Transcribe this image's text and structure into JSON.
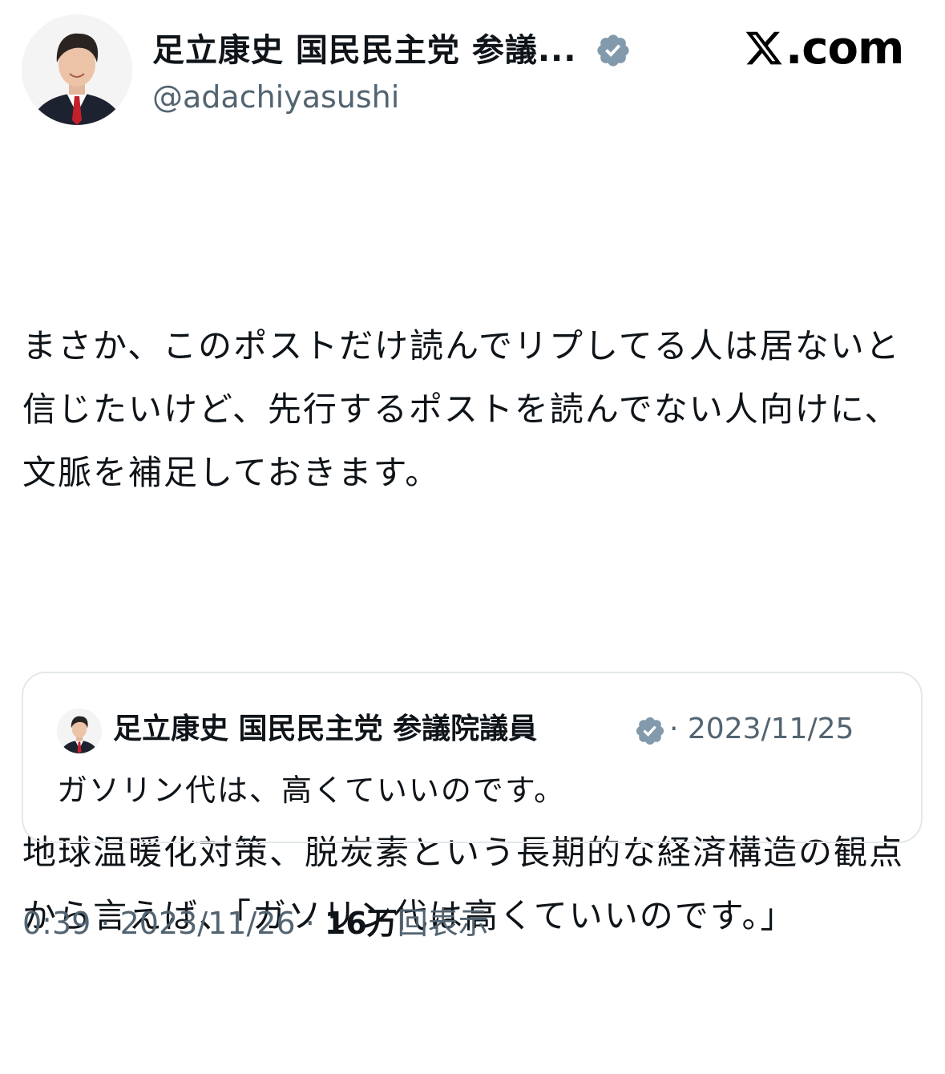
{
  "header": {
    "author_name": "足立康史 国民民主党 参議...",
    "handle": "@adachiyasushi",
    "verified_icon": "verified-badge-icon",
    "site_logo": ".com",
    "site_logo_icon": "x-logo-icon"
  },
  "post": {
    "paragraph1": "まさか、このポストだけ読んでリプしてる人は居ないと信じたいけど、先行するポストを読んでない人向けに、文脈を補足しておきます。",
    "paragraph2": "地球温暖化対策、脱炭素という長期的な経済構造の観点から言えば、「ガソリン代は高くていいのです。」"
  },
  "quote": {
    "author_name": "足立康史 国民民主党 参議院議員",
    "separator_date": "· 2023/11/25",
    "text": "ガソリン代は、高くていいのです。"
  },
  "meta": {
    "time": "0:39",
    "sep1": " · ",
    "date": "2023/11/26",
    "sep2": " · ",
    "views_count": "16万",
    "views_label": "回表示"
  },
  "colors": {
    "text": "#0f1419",
    "secondary": "#536471",
    "verified": "#829aab",
    "border": "#e3e8eb"
  }
}
